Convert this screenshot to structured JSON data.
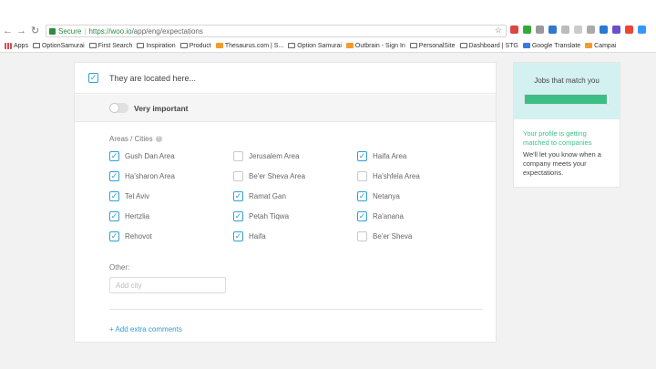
{
  "browser": {
    "secure_label": "Secure",
    "url_host": "https://woo.io",
    "url_path": "/app/eng/expectations",
    "bookmarks": [
      "Apps",
      "OptionSamurai",
      "First Search",
      "Inspiration",
      "Product",
      "Thesaurus.com | S...",
      "Option Samurai",
      "Outbrain - Sign In",
      "PersonalSite",
      "Dashboard | STG",
      "Google Translate",
      "Campai"
    ]
  },
  "location": {
    "label": "They are located here...",
    "checked": true
  },
  "importance": {
    "label": "Very important",
    "on": false
  },
  "areas": {
    "title": "Areas / Cities",
    "items": [
      {
        "label": "Gush Dan Area",
        "checked": true
      },
      {
        "label": "Jerusalem Area",
        "checked": false
      },
      {
        "label": "Haifa Area",
        "checked": true
      },
      {
        "label": "Ha'sharon Area",
        "checked": true
      },
      {
        "label": "Be'er Sheva Area",
        "checked": false
      },
      {
        "label": "Ha'shfela Area",
        "checked": false
      },
      {
        "label": "Tel Aviv",
        "checked": true
      },
      {
        "label": "Ramat Gan",
        "checked": true
      },
      {
        "label": "Netanya",
        "checked": true
      },
      {
        "label": "Hertzlia",
        "checked": true
      },
      {
        "label": "Petah Tiqwa",
        "checked": true
      },
      {
        "label": "Ra'anana",
        "checked": true
      },
      {
        "label": "Rehovot",
        "checked": true
      },
      {
        "label": "Haifa",
        "checked": true
      },
      {
        "label": "Be'er Sheva",
        "checked": false
      }
    ]
  },
  "other": {
    "label": "Other:",
    "placeholder": "Add city",
    "value": ""
  },
  "comments_link": "+ Add extra comments",
  "sidebar": {
    "title": "Jobs that match you",
    "progress": 0.98,
    "status_green": "Your profile is getting matched to companies",
    "status_text": "We'll let you know when a company meets your expectations."
  },
  "colors": {
    "accent": "#2e9fd6",
    "progress_green": "#3bbf86",
    "sidebar_header": "#d4f1f2"
  }
}
